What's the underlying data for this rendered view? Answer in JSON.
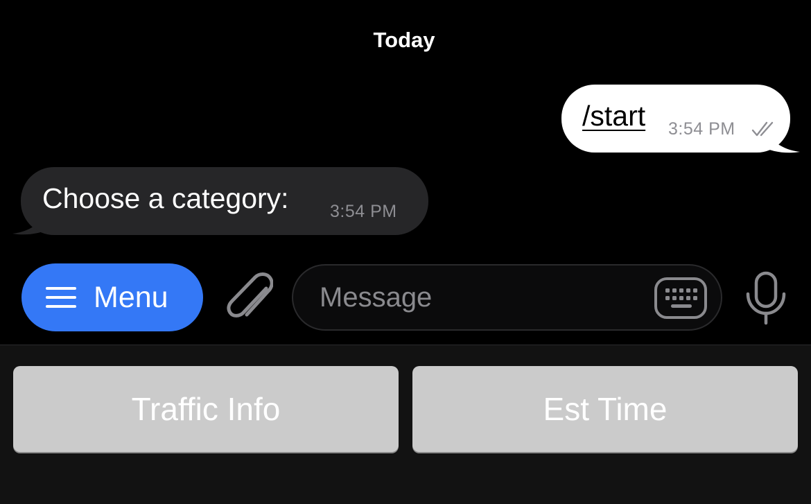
{
  "chat": {
    "date_header": "Today",
    "messages": [
      {
        "direction": "outgoing",
        "text": "/start",
        "time": "3:54 PM",
        "status": "read"
      },
      {
        "direction": "incoming",
        "text": "Choose a category:",
        "time": "3:54 PM"
      }
    ]
  },
  "input_bar": {
    "menu_label": "Menu",
    "message_placeholder": "Message",
    "message_value": "",
    "icons": {
      "menu": "hamburger-icon",
      "attach": "paperclip-icon",
      "keyboard": "keyboard-icon",
      "mic": "microphone-icon"
    }
  },
  "reply_keyboard": {
    "buttons": [
      {
        "label": "Traffic Info"
      },
      {
        "label": "Est Time"
      }
    ]
  },
  "colors": {
    "background": "#000000",
    "menu_button": "#3478f6",
    "outgoing_bubble": "#ffffff",
    "incoming_bubble": "#262628",
    "reply_button": "#cbcbcb",
    "timestamp": "#8e8e93"
  }
}
